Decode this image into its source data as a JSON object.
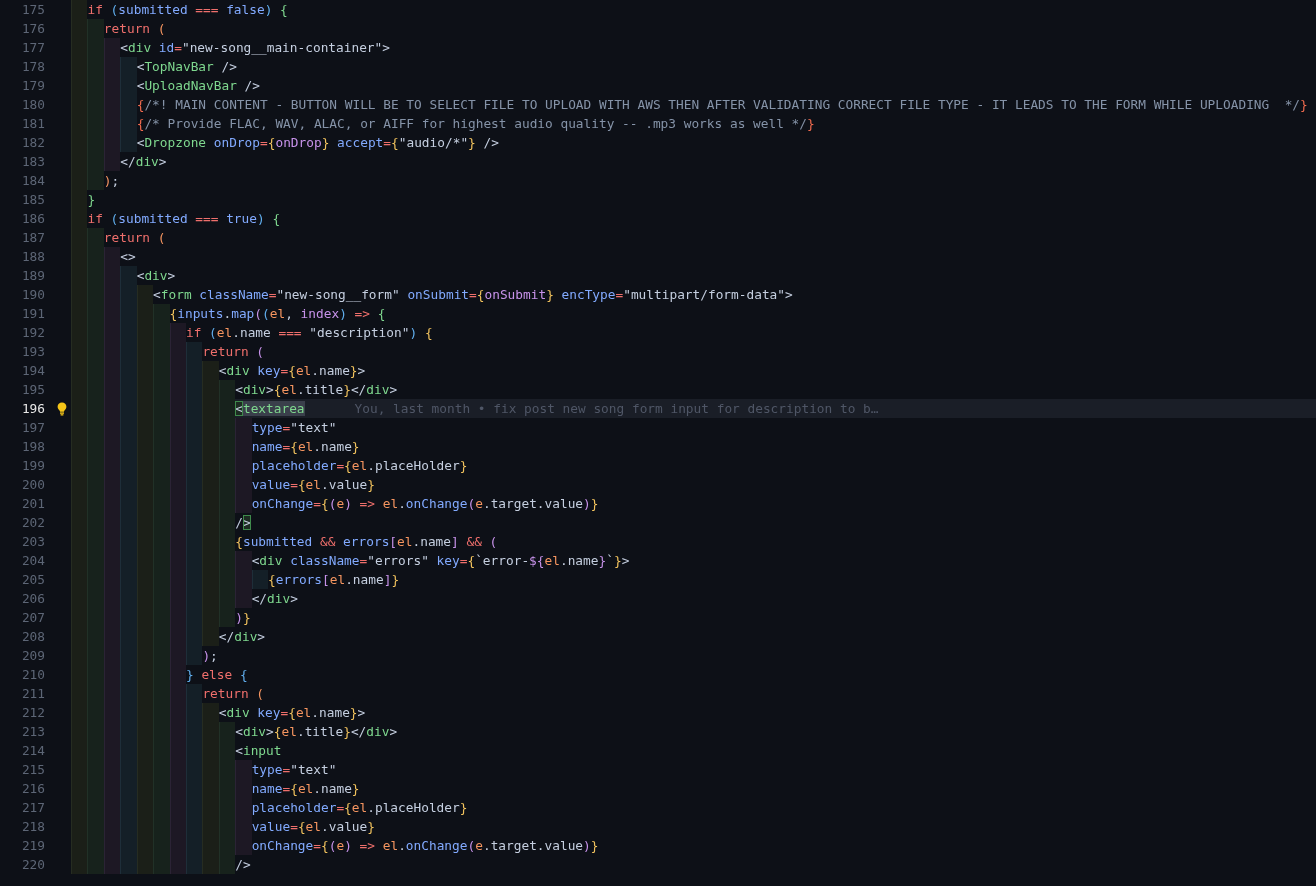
{
  "editor": {
    "lines": [
      {
        "number": "175",
        "current": false,
        "tokens": [
          {
            "text": "  if",
            "kind": "kw"
          },
          {
            "text": " (",
            "kind": "b"
          },
          {
            "text": "submitted",
            "kind": "id"
          },
          {
            "text": " ===",
            "kind": "kw"
          },
          {
            "text": " false",
            "kind": "id"
          },
          {
            "text": ")",
            "kind": "b"
          },
          {
            "text": " {",
            "kind": "g"
          }
        ]
      },
      {
        "number": "176",
        "current": false,
        "tokens": [
          {
            "text": "    return",
            "kind": "kw"
          },
          {
            "text": " (",
            "kind": "o"
          }
        ]
      },
      {
        "number": "177",
        "current": false,
        "tokens": [
          {
            "text": "      <",
            "kind": "tx"
          },
          {
            "text": "div",
            "kind": "tag"
          },
          {
            "text": " id",
            "kind": "id"
          },
          {
            "text": "=",
            "kind": "kw"
          },
          {
            "text": "\"new-song__main-container\">",
            "kind": "tx"
          }
        ]
      },
      {
        "number": "178",
        "current": false,
        "tokens": [
          {
            "text": "        <",
            "kind": "tx"
          },
          {
            "text": "TopNavBar",
            "kind": "tag"
          },
          {
            "text": " />",
            "kind": "tx"
          }
        ]
      },
      {
        "number": "179",
        "current": false,
        "tokens": [
          {
            "text": "        <",
            "kind": "tx"
          },
          {
            "text": "UploadNavBar",
            "kind": "tag"
          },
          {
            "text": " />",
            "kind": "tx"
          }
        ]
      },
      {
        "number": "180",
        "current": false,
        "tokens": [
          {
            "text": "        {",
            "kind": "r"
          },
          {
            "text": "/*! MAIN CONTENT - BUTTON WILL BE TO SELECT FILE TO UPLOAD WITH AWS THEN AFTER VALIDATING CORRECT FILE TYPE - IT LEADS TO THE FORM WHILE UPLOADING  */",
            "kind": "cm"
          },
          {
            "text": "}",
            "kind": "r"
          }
        ]
      },
      {
        "number": "181",
        "current": false,
        "tokens": [
          {
            "text": "        {",
            "kind": "r"
          },
          {
            "text": "/* Provide FLAC, WAV, ALAC, or AIFF for highest audio quality -- .mp3 works as well */",
            "kind": "cm"
          },
          {
            "text": "}",
            "kind": "r"
          }
        ]
      },
      {
        "number": "182",
        "current": false,
        "tokens": [
          {
            "text": "        <",
            "kind": "tx"
          },
          {
            "text": "Dropzone",
            "kind": "tag"
          },
          {
            "text": " onDrop",
            "kind": "id"
          },
          {
            "text": "=",
            "kind": "kw"
          },
          {
            "text": "{",
            "kind": "y"
          },
          {
            "text": "onDrop",
            "kind": "p"
          },
          {
            "text": "}",
            "kind": "y"
          },
          {
            "text": " accept",
            "kind": "id"
          },
          {
            "text": "=",
            "kind": "kw"
          },
          {
            "text": "{",
            "kind": "y"
          },
          {
            "text": "\"audio/*\"",
            "kind": "tx"
          },
          {
            "text": "}",
            "kind": "y"
          },
          {
            "text": " />",
            "kind": "tx"
          }
        ]
      },
      {
        "number": "183",
        "current": false,
        "tokens": [
          {
            "text": "      </",
            "kind": "tx"
          },
          {
            "text": "div",
            "kind": "tag"
          },
          {
            "text": ">",
            "kind": "tx"
          }
        ]
      },
      {
        "number": "184",
        "current": false,
        "tokens": [
          {
            "text": "    )",
            "kind": "o"
          },
          {
            "text": ";",
            "kind": "tx"
          }
        ]
      },
      {
        "number": "185",
        "current": false,
        "tokens": [
          {
            "text": "  }",
            "kind": "g"
          }
        ]
      },
      {
        "number": "186",
        "current": false,
        "tokens": [
          {
            "text": "  if",
            "kind": "kw"
          },
          {
            "text": " (",
            "kind": "b"
          },
          {
            "text": "submitted",
            "kind": "id"
          },
          {
            "text": " ===",
            "kind": "kw"
          },
          {
            "text": " true",
            "kind": "id"
          },
          {
            "text": ")",
            "kind": "b"
          },
          {
            "text": " {",
            "kind": "g"
          }
        ]
      },
      {
        "number": "187",
        "current": false,
        "tokens": [
          {
            "text": "    return",
            "kind": "kw"
          },
          {
            "text": " (",
            "kind": "o"
          }
        ]
      },
      {
        "number": "188",
        "current": false,
        "tokens": [
          {
            "text": "      <>",
            "kind": "tx"
          }
        ]
      },
      {
        "number": "189",
        "current": false,
        "tokens": [
          {
            "text": "        <",
            "kind": "tx"
          },
          {
            "text": "div",
            "kind": "tag"
          },
          {
            "text": ">",
            "kind": "tx"
          }
        ]
      },
      {
        "number": "190",
        "current": false,
        "tokens": [
          {
            "text": "          <",
            "kind": "tx"
          },
          {
            "text": "form",
            "kind": "tag"
          },
          {
            "text": " className",
            "kind": "id"
          },
          {
            "text": "=",
            "kind": "kw"
          },
          {
            "text": "\"new-song__form\"",
            "kind": "tx"
          },
          {
            "text": " onSubmit",
            "kind": "id"
          },
          {
            "text": "=",
            "kind": "kw"
          },
          {
            "text": "{",
            "kind": "y"
          },
          {
            "text": "onSubmit",
            "kind": "p"
          },
          {
            "text": "}",
            "kind": "y"
          },
          {
            "text": " encType",
            "kind": "id"
          },
          {
            "text": "=",
            "kind": "kw"
          },
          {
            "text": "\"multipart/form-data\">",
            "kind": "tx"
          }
        ]
      },
      {
        "number": "191",
        "current": false,
        "tokens": [
          {
            "text": "            {",
            "kind": "y"
          },
          {
            "text": "inputs",
            "kind": "id"
          },
          {
            "text": ".",
            "kind": "tx"
          },
          {
            "text": "map",
            "kind": "id"
          },
          {
            "text": "(",
            "kind": "p"
          },
          {
            "text": "(",
            "kind": "b"
          },
          {
            "text": "el",
            "kind": "o"
          },
          {
            "text": ", ",
            "kind": "tx"
          },
          {
            "text": "index",
            "kind": "p"
          },
          {
            "text": ")",
            "kind": "b"
          },
          {
            "text": " =>",
            "kind": "kw"
          },
          {
            "text": " {",
            "kind": "g"
          }
        ]
      },
      {
        "number": "192",
        "current": false,
        "tokens": [
          {
            "text": "              if",
            "kind": "kw"
          },
          {
            "text": " (",
            "kind": "b"
          },
          {
            "text": "el",
            "kind": "o"
          },
          {
            "text": ".name",
            "kind": "tx"
          },
          {
            "text": " ===",
            "kind": "kw"
          },
          {
            "text": " \"description\"",
            "kind": "tx"
          },
          {
            "text": ")",
            "kind": "b"
          },
          {
            "text": " {",
            "kind": "y"
          }
        ]
      },
      {
        "number": "193",
        "current": false,
        "tokens": [
          {
            "text": "                return",
            "kind": "kw"
          },
          {
            "text": " (",
            "kind": "p"
          }
        ]
      },
      {
        "number": "194",
        "current": false,
        "tokens": [
          {
            "text": "                  <",
            "kind": "tx"
          },
          {
            "text": "div",
            "kind": "tag"
          },
          {
            "text": " key",
            "kind": "id"
          },
          {
            "text": "=",
            "kind": "kw"
          },
          {
            "text": "{",
            "kind": "y"
          },
          {
            "text": "el",
            "kind": "o"
          },
          {
            "text": ".name",
            "kind": "tx"
          },
          {
            "text": "}",
            "kind": "y"
          },
          {
            "text": ">",
            "kind": "tx"
          }
        ]
      },
      {
        "number": "195",
        "current": false,
        "tokens": [
          {
            "text": "                    <",
            "kind": "tx"
          },
          {
            "text": "div",
            "kind": "tag"
          },
          {
            "text": ">",
            "kind": "tx"
          },
          {
            "text": "{",
            "kind": "y"
          },
          {
            "text": "el",
            "kind": "o"
          },
          {
            "text": ".title",
            "kind": "tx"
          },
          {
            "text": "}",
            "kind": "y"
          },
          {
            "text": "</",
            "kind": "tx"
          },
          {
            "text": "div",
            "kind": "tag"
          },
          {
            "text": ">",
            "kind": "tx"
          }
        ]
      },
      {
        "number": "196",
        "current": true,
        "blame": "You, last month • fix post new song form input for description to b…",
        "tokens": [
          {
            "text": "                    <",
            "kind": "tx",
            "matched": true
          },
          {
            "text": "textarea",
            "kind": "tag",
            "highlighted": true
          }
        ]
      },
      {
        "number": "197",
        "current": false,
        "tokens": [
          {
            "text": "                      type",
            "kind": "id"
          },
          {
            "text": "=",
            "kind": "kw"
          },
          {
            "text": "\"text\"",
            "kind": "tx"
          }
        ]
      },
      {
        "number": "198",
        "current": false,
        "tokens": [
          {
            "text": "                      name",
            "kind": "id"
          },
          {
            "text": "=",
            "kind": "kw"
          },
          {
            "text": "{",
            "kind": "y"
          },
          {
            "text": "el",
            "kind": "o"
          },
          {
            "text": ".name",
            "kind": "tx"
          },
          {
            "text": "}",
            "kind": "y"
          }
        ]
      },
      {
        "number": "199",
        "current": false,
        "tokens": [
          {
            "text": "                      placeholder",
            "kind": "id"
          },
          {
            "text": "=",
            "kind": "kw"
          },
          {
            "text": "{",
            "kind": "y"
          },
          {
            "text": "el",
            "kind": "o"
          },
          {
            "text": ".placeHolder",
            "kind": "tx"
          },
          {
            "text": "}",
            "kind": "y"
          }
        ]
      },
      {
        "number": "200",
        "current": false,
        "tokens": [
          {
            "text": "                      value",
            "kind": "id"
          },
          {
            "text": "=",
            "kind": "kw"
          },
          {
            "text": "{",
            "kind": "y"
          },
          {
            "text": "el",
            "kind": "o"
          },
          {
            "text": ".value",
            "kind": "tx"
          },
          {
            "text": "}",
            "kind": "y"
          }
        ]
      },
      {
        "number": "201",
        "current": false,
        "tokens": [
          {
            "text": "                      onChange",
            "kind": "id"
          },
          {
            "text": "=",
            "kind": "kw"
          },
          {
            "text": "{",
            "kind": "y"
          },
          {
            "text": "(",
            "kind": "p"
          },
          {
            "text": "e",
            "kind": "o"
          },
          {
            "text": ")",
            "kind": "p"
          },
          {
            "text": " =>",
            "kind": "kw"
          },
          {
            "text": " el",
            "kind": "o"
          },
          {
            "text": ".",
            "kind": "tx"
          },
          {
            "text": "onChange",
            "kind": "id"
          },
          {
            "text": "(",
            "kind": "p"
          },
          {
            "text": "e",
            "kind": "o"
          },
          {
            "text": ".target.value",
            "kind": "tx"
          },
          {
            "text": ")",
            "kind": "p"
          },
          {
            "text": "}",
            "kind": "y"
          }
        ]
      },
      {
        "number": "202",
        "current": false,
        "tokens": [
          {
            "text": "                    /",
            "kind": "tx"
          },
          {
            "text": ">",
            "kind": "tx",
            "matched": true
          }
        ]
      },
      {
        "number": "203",
        "current": false,
        "tokens": [
          {
            "text": "                    {",
            "kind": "y"
          },
          {
            "text": "submitted",
            "kind": "id"
          },
          {
            "text": " &&",
            "kind": "kw"
          },
          {
            "text": " errors",
            "kind": "id"
          },
          {
            "text": "[",
            "kind": "p"
          },
          {
            "text": "el",
            "kind": "o"
          },
          {
            "text": ".name",
            "kind": "tx"
          },
          {
            "text": "]",
            "kind": "p"
          },
          {
            "text": " &&",
            "kind": "kw"
          },
          {
            "text": " (",
            "kind": "p"
          }
        ]
      },
      {
        "number": "204",
        "current": false,
        "tokens": [
          {
            "text": "                      <",
            "kind": "tx"
          },
          {
            "text": "div",
            "kind": "tag"
          },
          {
            "text": " className",
            "kind": "id"
          },
          {
            "text": "=",
            "kind": "kw"
          },
          {
            "text": "\"errors\"",
            "kind": "tx"
          },
          {
            "text": " key",
            "kind": "id"
          },
          {
            "text": "=",
            "kind": "kw"
          },
          {
            "text": "{",
            "kind": "y"
          },
          {
            "text": "`error-",
            "kind": "tx"
          },
          {
            "text": "${",
            "kind": "p"
          },
          {
            "text": "el",
            "kind": "o"
          },
          {
            "text": ".name",
            "kind": "tx"
          },
          {
            "text": "}",
            "kind": "p"
          },
          {
            "text": "`",
            "kind": "tx"
          },
          {
            "text": "}",
            "kind": "y"
          },
          {
            "text": ">",
            "kind": "tx"
          }
        ]
      },
      {
        "number": "205",
        "current": false,
        "tokens": [
          {
            "text": "                        {",
            "kind": "y"
          },
          {
            "text": "errors",
            "kind": "id"
          },
          {
            "text": "[",
            "kind": "p"
          },
          {
            "text": "el",
            "kind": "o"
          },
          {
            "text": ".name",
            "kind": "tx"
          },
          {
            "text": "]",
            "kind": "p"
          },
          {
            "text": "}",
            "kind": "y"
          }
        ]
      },
      {
        "number": "206",
        "current": false,
        "tokens": [
          {
            "text": "                      </",
            "kind": "tx"
          },
          {
            "text": "div",
            "kind": "tag"
          },
          {
            "text": ">",
            "kind": "tx"
          }
        ]
      },
      {
        "number": "207",
        "current": false,
        "tokens": [
          {
            "text": "                    )",
            "kind": "p"
          },
          {
            "text": "}",
            "kind": "y"
          }
        ]
      },
      {
        "number": "208",
        "current": false,
        "tokens": [
          {
            "text": "                  </",
            "kind": "tx"
          },
          {
            "text": "div",
            "kind": "tag"
          },
          {
            "text": ">",
            "kind": "tx"
          }
        ]
      },
      {
        "number": "209",
        "current": false,
        "tokens": [
          {
            "text": "                )",
            "kind": "p"
          },
          {
            "text": ";",
            "kind": "tx"
          }
        ]
      },
      {
        "number": "210",
        "current": false,
        "tokens": [
          {
            "text": "              }",
            "kind": "b"
          },
          {
            "text": " else",
            "kind": "kw"
          },
          {
            "text": " {",
            "kind": "b"
          }
        ]
      },
      {
        "number": "211",
        "current": false,
        "tokens": [
          {
            "text": "                return",
            "kind": "kw"
          },
          {
            "text": " (",
            "kind": "o"
          }
        ]
      },
      {
        "number": "212",
        "current": false,
        "tokens": [
          {
            "text": "                  <",
            "kind": "tx"
          },
          {
            "text": "div",
            "kind": "tag"
          },
          {
            "text": " key",
            "kind": "id"
          },
          {
            "text": "=",
            "kind": "kw"
          },
          {
            "text": "{",
            "kind": "y"
          },
          {
            "text": "el",
            "kind": "o"
          },
          {
            "text": ".name",
            "kind": "tx"
          },
          {
            "text": "}",
            "kind": "y"
          },
          {
            "text": ">",
            "kind": "tx"
          }
        ]
      },
      {
        "number": "213",
        "current": false,
        "tokens": [
          {
            "text": "                    <",
            "kind": "tx"
          },
          {
            "text": "div",
            "kind": "tag"
          },
          {
            "text": ">",
            "kind": "tx"
          },
          {
            "text": "{",
            "kind": "y"
          },
          {
            "text": "el",
            "kind": "o"
          },
          {
            "text": ".title",
            "kind": "tx"
          },
          {
            "text": "}",
            "kind": "y"
          },
          {
            "text": "</",
            "kind": "tx"
          },
          {
            "text": "div",
            "kind": "tag"
          },
          {
            "text": ">",
            "kind": "tx"
          }
        ]
      },
      {
        "number": "214",
        "current": false,
        "tokens": [
          {
            "text": "                    <",
            "kind": "tx"
          },
          {
            "text": "input",
            "kind": "tag"
          }
        ]
      },
      {
        "number": "215",
        "current": false,
        "tokens": [
          {
            "text": "                      type",
            "kind": "id"
          },
          {
            "text": "=",
            "kind": "kw"
          },
          {
            "text": "\"text\"",
            "kind": "tx"
          }
        ]
      },
      {
        "number": "216",
        "current": false,
        "tokens": [
          {
            "text": "                      name",
            "kind": "id"
          },
          {
            "text": "=",
            "kind": "kw"
          },
          {
            "text": "{",
            "kind": "y"
          },
          {
            "text": "el",
            "kind": "o"
          },
          {
            "text": ".name",
            "kind": "tx"
          },
          {
            "text": "}",
            "kind": "y"
          }
        ]
      },
      {
        "number": "217",
        "current": false,
        "tokens": [
          {
            "text": "                      placeholder",
            "kind": "id"
          },
          {
            "text": "=",
            "kind": "kw"
          },
          {
            "text": "{",
            "kind": "y"
          },
          {
            "text": "el",
            "kind": "o"
          },
          {
            "text": ".placeHolder",
            "kind": "tx"
          },
          {
            "text": "}",
            "kind": "y"
          }
        ]
      },
      {
        "number": "218",
        "current": false,
        "tokens": [
          {
            "text": "                      value",
            "kind": "id"
          },
          {
            "text": "=",
            "kind": "kw"
          },
          {
            "text": "{",
            "kind": "y"
          },
          {
            "text": "el",
            "kind": "o"
          },
          {
            "text": ".value",
            "kind": "tx"
          },
          {
            "text": "}",
            "kind": "y"
          }
        ]
      },
      {
        "number": "219",
        "current": false,
        "tokens": [
          {
            "text": "                      onChange",
            "kind": "id"
          },
          {
            "text": "=",
            "kind": "kw"
          },
          {
            "text": "{",
            "kind": "y"
          },
          {
            "text": "(",
            "kind": "p"
          },
          {
            "text": "e",
            "kind": "o"
          },
          {
            "text": ")",
            "kind": "p"
          },
          {
            "text": " =>",
            "kind": "kw"
          },
          {
            "text": " el",
            "kind": "o"
          },
          {
            "text": ".",
            "kind": "tx"
          },
          {
            "text": "onChange",
            "kind": "id"
          },
          {
            "text": "(",
            "kind": "p"
          },
          {
            "text": "e",
            "kind": "o"
          },
          {
            "text": ".target.value",
            "kind": "tx"
          },
          {
            "text": ")",
            "kind": "p"
          },
          {
            "text": "}",
            "kind": "y"
          }
        ]
      },
      {
        "number": "220",
        "current": false,
        "tokens": [
          {
            "text": "                    />",
            "kind": "tx"
          }
        ]
      }
    ]
  }
}
